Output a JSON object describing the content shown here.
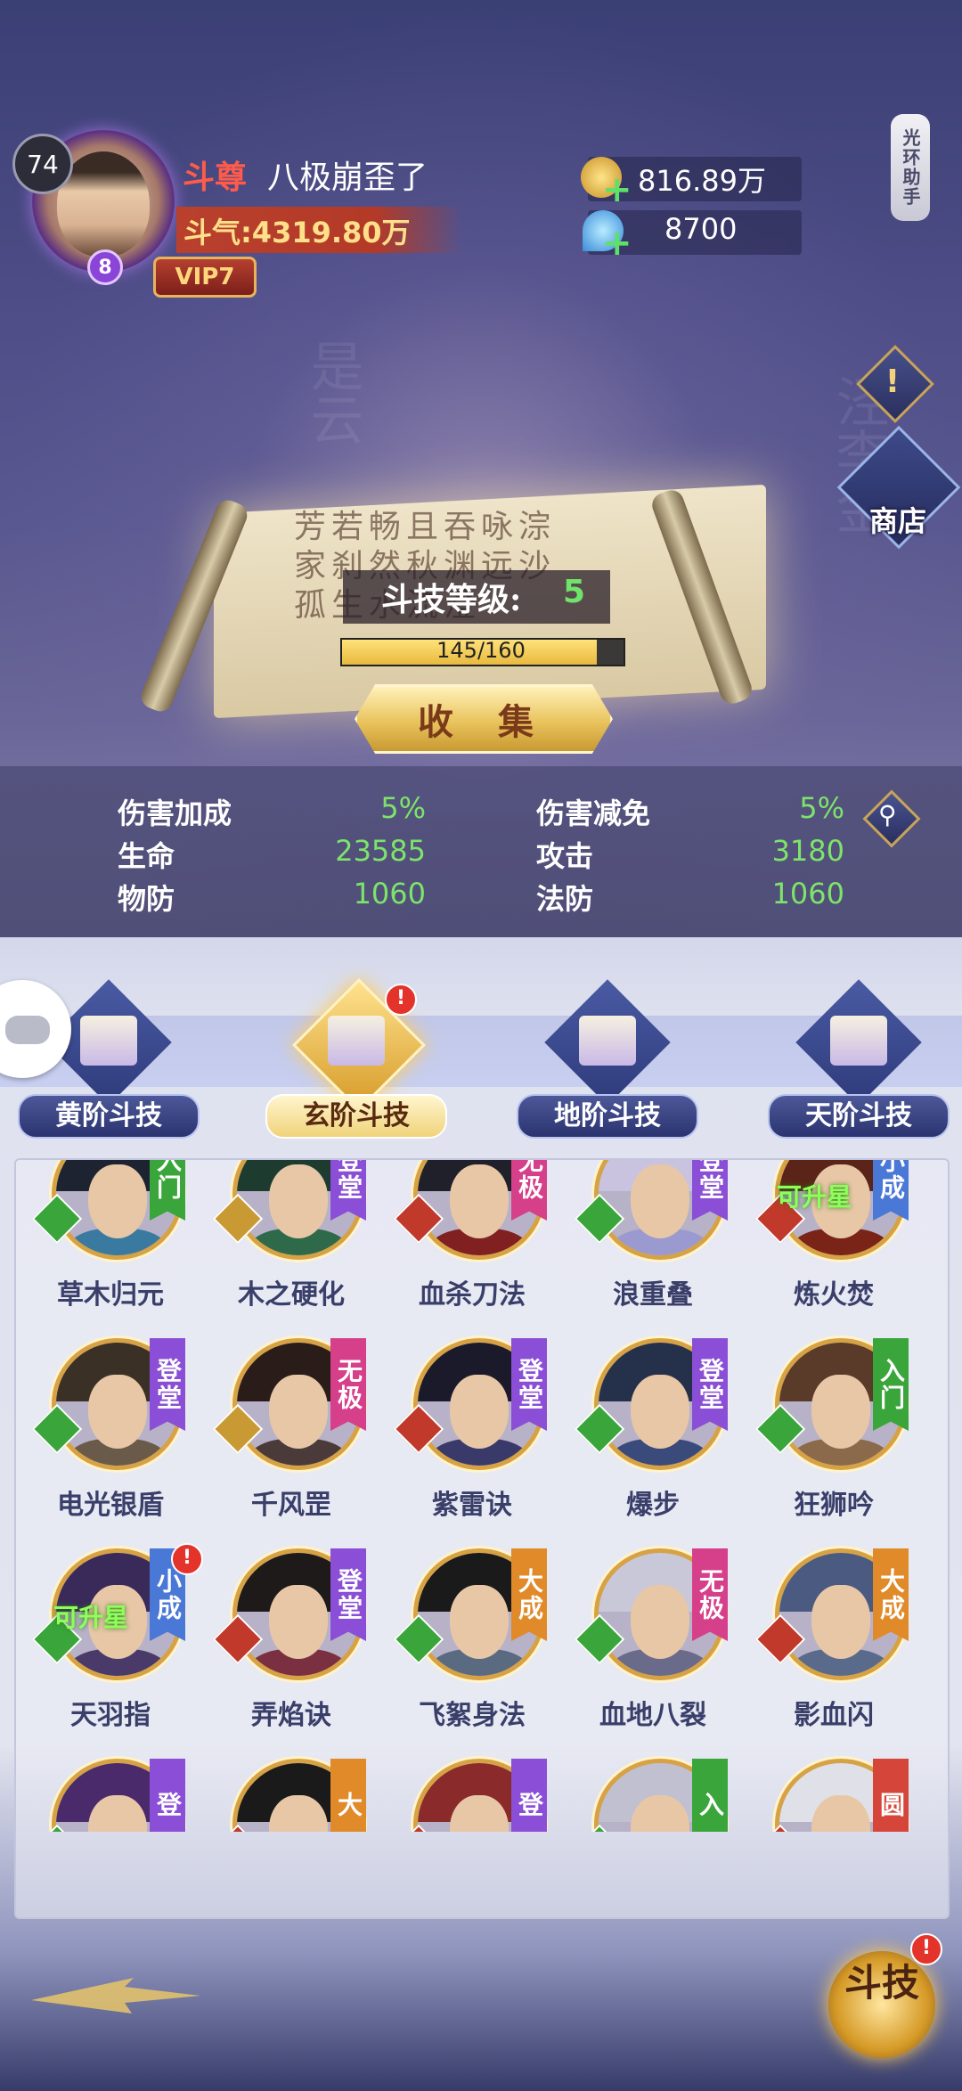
{
  "player": {
    "level": "74",
    "rank_title": "斗尊",
    "name": "八极崩歪了",
    "power_text": "斗气:4319.80万",
    "star": "8",
    "vip": "VIP7"
  },
  "resources": {
    "gold": "816.89万",
    "gems": "8700"
  },
  "helper_tab": "光环助手",
  "info_mark": "!",
  "shop_label": "商店",
  "skill": {
    "level_label": "斗技等级:",
    "level_value": "5",
    "xp_text": "145/160",
    "xp_fraction": 0.906,
    "collect_label": "收 集"
  },
  "stats": [
    {
      "label": "伤害加成",
      "value": "5%"
    },
    {
      "label": "伤害减免",
      "value": "5%"
    },
    {
      "label": "生命",
      "value": "23585"
    },
    {
      "label": "攻击",
      "value": "3180"
    },
    {
      "label": "物防",
      "value": "1060"
    },
    {
      "label": "法防",
      "value": "1060"
    }
  ],
  "tabs": [
    {
      "label": "黄阶斗技",
      "active": false,
      "alert": false
    },
    {
      "label": "玄阶斗技",
      "active": true,
      "alert": true
    },
    {
      "label": "地阶斗技",
      "active": false,
      "alert": false
    },
    {
      "label": "天阶斗技",
      "active": false,
      "alert": false
    }
  ],
  "alert_symbol": "!",
  "skills": [
    {
      "name": "草木归元",
      "rank": "入门",
      "rank_color": "#3aa53a",
      "emblem_color": "#3aa53a",
      "hint": ""
    },
    {
      "name": "木之硬化",
      "rank": "登堂",
      "rank_color": "#8a4fd6",
      "emblem_color": "#c99a33",
      "hint": ""
    },
    {
      "name": "血杀刀法",
      "rank": "无极",
      "rank_color": "#d63f8a",
      "emblem_color": "#c0392b",
      "hint": ""
    },
    {
      "name": "浪重叠",
      "rank": "登堂",
      "rank_color": "#8a4fd6",
      "emblem_color": "#3aa53a",
      "hint": ""
    },
    {
      "name": "炼火焚",
      "rank": "小成",
      "rank_color": "#4a78d6",
      "emblem_color": "#c0392b",
      "hint": "可升星"
    },
    {
      "name": "电光银盾",
      "rank": "登堂",
      "rank_color": "#8a4fd6",
      "emblem_color": "#3aa53a",
      "hint": ""
    },
    {
      "name": "千风罡",
      "rank": "无极",
      "rank_color": "#d63f8a",
      "emblem_color": "#c99a33",
      "hint": ""
    },
    {
      "name": "紫雷诀",
      "rank": "登堂",
      "rank_color": "#8a4fd6",
      "emblem_color": "#c0392b",
      "hint": ""
    },
    {
      "name": "爆步",
      "rank": "登堂",
      "rank_color": "#8a4fd6",
      "emblem_color": "#3aa53a",
      "hint": ""
    },
    {
      "name": "狂狮吟",
      "rank": "入门",
      "rank_color": "#3aa53a",
      "emblem_color": "#3aa53a",
      "hint": ""
    },
    {
      "name": "天羽指",
      "rank": "小成",
      "rank_color": "#4a78d6",
      "emblem_color": "#3aa53a",
      "hint": "可升星",
      "alert": true
    },
    {
      "name": "弄焰诀",
      "rank": "登堂",
      "rank_color": "#8a4fd6",
      "emblem_color": "#c0392b",
      "hint": ""
    },
    {
      "name": "飞絮身法",
      "rank": "大成",
      "rank_color": "#e08a2a",
      "emblem_color": "#3aa53a",
      "hint": ""
    },
    {
      "name": "血地八裂",
      "rank": "无极",
      "rank_color": "#d63f8a",
      "emblem_color": "#3aa53a",
      "hint": ""
    },
    {
      "name": "影血闪",
      "rank": "大成",
      "rank_color": "#e08a2a",
      "emblem_color": "#c0392b",
      "hint": ""
    },
    {
      "name": "",
      "rank": "登",
      "rank_color": "#8a4fd6",
      "emblem_color": "#3aa53a",
      "hint": ""
    },
    {
      "name": "",
      "rank": "大",
      "rank_color": "#e08a2a",
      "emblem_color": "#c0392b",
      "hint": ""
    },
    {
      "name": "",
      "rank": "登",
      "rank_color": "#8a4fd6",
      "emblem_color": "#c0392b",
      "hint": ""
    },
    {
      "name": "",
      "rank": "入",
      "rank_color": "#3aa53a",
      "emblem_color": "#3aa53a",
      "hint": ""
    },
    {
      "name": "",
      "rank": "圆",
      "rank_color": "#d6453a",
      "emblem_color": "#c0392b",
      "hint": ""
    }
  ],
  "bottom_button": "斗技",
  "icons": [
    "gold-coin-icon",
    "blue-gem-icon",
    "plus-icon",
    "info-icon",
    "shop-icon",
    "search-icon",
    "gamepad-icon",
    "scroll-book-icon",
    "arrow-icon"
  ]
}
